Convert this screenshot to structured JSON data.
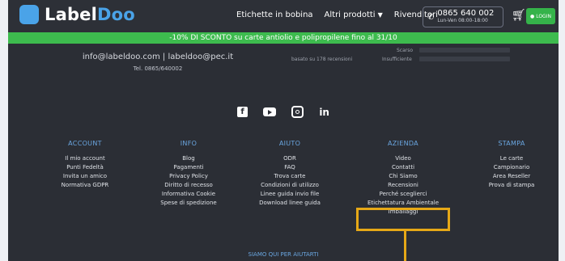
{
  "brand": {
    "logo_mark": "",
    "name_main": "Label",
    "name_accent": "Doo"
  },
  "nav": {
    "links": [
      "Etichette in bobina",
      "Altri prodotti",
      "Rivenditori"
    ],
    "phone": "0865 640 002",
    "phone_hours": "Lun-Ven 08:00-18:00",
    "login": "LOGIN"
  },
  "promo": {
    "text": "-10% DI SCONTO su carte antiolio e polipropilene fino al 31/10"
  },
  "contact": {
    "email_line": "info@labeldoo.com | labeldoo@pec.it",
    "tel": "Tel. 0865/640002"
  },
  "reviews": {
    "summary": "basato su 178 recensioni",
    "label_scarso": "Scarso",
    "label_insufficiente": "Insufficiente"
  },
  "socials": [
    "facebook-icon",
    "youtube-icon",
    "instagram-icon",
    "linkedin-icon"
  ],
  "footer": {
    "columns": [
      {
        "heading": "ACCOUNT",
        "links": [
          "Il mio account",
          "Punti Fedeltà",
          "Invita un amico",
          "Normativa GDPR"
        ]
      },
      {
        "heading": "INFO",
        "links": [
          "Blog",
          "Pagamenti",
          "Privacy Policy",
          "Diritto di recesso",
          "Informativa Cookie",
          "Spese di spedizione"
        ]
      },
      {
        "heading": "AIUTO",
        "links": [
          "ODR",
          "FAQ",
          "Trova carte",
          "Condizioni di utilizzo",
          "Linee guida invio file",
          "Download linee guida"
        ]
      },
      {
        "heading": "AZIENDA",
        "links": [
          "Video",
          "Contatti",
          "Chi Siamo",
          "Recensioni",
          "Perché sceglierci",
          "Etichettatura Ambientale",
          "Imballaggi"
        ]
      },
      {
        "heading": "STAMPA",
        "links": [
          "Le carte",
          "Campionario",
          "Area Reseller",
          "Prova di stampa"
        ]
      }
    ],
    "help_text": "SIAMO QUI PER AIUTARTI"
  },
  "colors": {
    "highlight": "#e6a817",
    "promo": "#3dbb4e",
    "accent": "#4aa3e8",
    "background": "#2b2e35"
  }
}
